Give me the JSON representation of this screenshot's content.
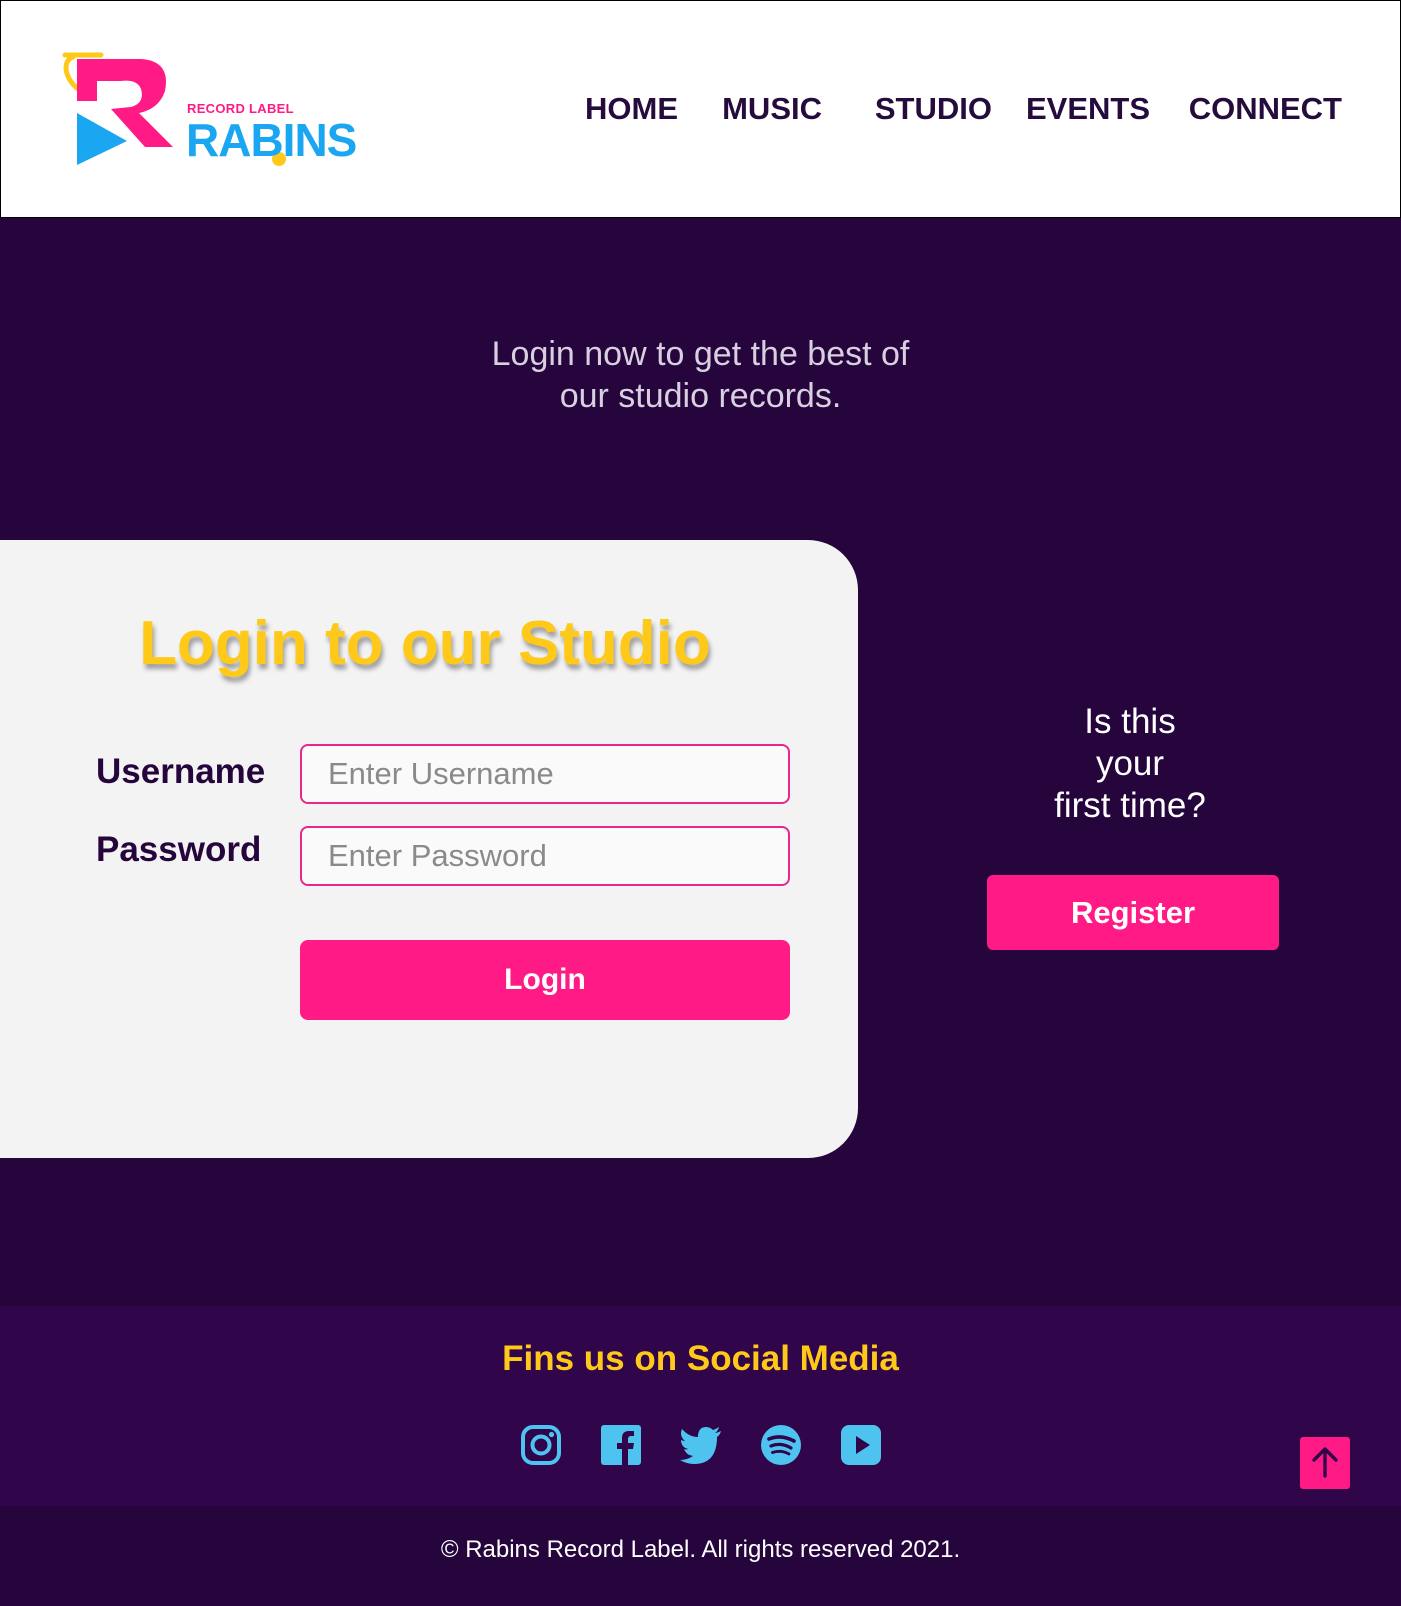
{
  "header": {
    "logo": {
      "small_text": "RECORD LABEL",
      "brand_text": "RABINS",
      "colors": {
        "pink": "#ff1a86",
        "blue": "#1aa6f0",
        "yellow": "#ffc91a"
      }
    },
    "nav": [
      {
        "label": "HOME"
      },
      {
        "label": "MUSIC"
      },
      {
        "label": "STUDIO"
      },
      {
        "label": "EVENTS"
      },
      {
        "label": "CONNECT"
      }
    ]
  },
  "main": {
    "intro_line1": "Login now to get the best of",
    "intro_line2": "our studio records.",
    "login_card": {
      "title": "Login to our Studio",
      "username_label": "Username",
      "username_placeholder": "Enter Username",
      "username_value": "",
      "password_label": "Password",
      "password_placeholder": "Enter Password",
      "password_value": "",
      "login_button": "Login"
    },
    "register": {
      "prompt_line1": "Is this",
      "prompt_line2": "your",
      "prompt_line3": "first time?",
      "button": "Register"
    }
  },
  "footer": {
    "social_title": "Fins us on Social Media",
    "social_icons": [
      "instagram-icon",
      "facebook-icon",
      "twitter-icon",
      "spotify-icon",
      "youtube-icon"
    ],
    "scroll_top_icon": "arrow-up-icon",
    "copyright": "© Rabins Record Label. All rights reserved 2021."
  },
  "colors": {
    "background_dark": "#25053c",
    "footer_purple": "#30054a",
    "accent_pink": "#ff1a86",
    "accent_yellow": "#ffc91a",
    "icon_blue": "#4fc3f0",
    "card_bg": "#f3f3f3"
  }
}
